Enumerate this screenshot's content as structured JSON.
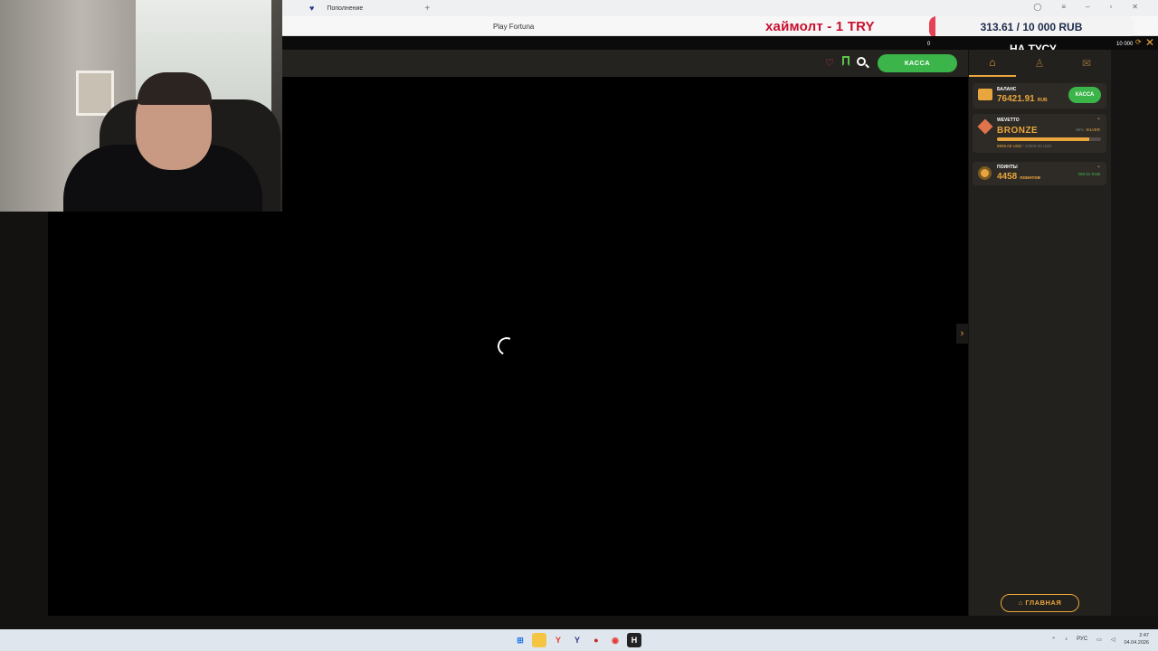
{
  "browser": {
    "tab_title": "Пополнение",
    "page_title": "Play Fortuna"
  },
  "overlay": {
    "promo_text": "хаймолт - 1 TRY",
    "goal_text": "313.61 / 10 000 RUB",
    "goal_progress": 0.031,
    "goal_min": "0",
    "goal_max": "10 000",
    "goal_label": "НА ТУСУ"
  },
  "header": {
    "kassa_label": "КАССА"
  },
  "sidebar": {
    "balance_label": "БАЛАНС",
    "balance_value": "76421.91",
    "balance_currency": "RUB",
    "balance_button": "КАССА",
    "loyalty_label": "WEVETTO",
    "loyalty_level": "BRONZE",
    "loyalty_next_pct": "89%",
    "loyalty_next_level": "SILVER",
    "loyalty_progress": 0.89,
    "loyalty_current": "8909.00 USD",
    "loyalty_total": "/ 10000.00 USD",
    "points_label": "ПОИНТЫ",
    "points_value": "4458",
    "points_unit": "поинтов",
    "points_rub": "398.91 RUB",
    "home_button": "ГЛАВНАЯ"
  },
  "taskbar": {
    "lang": "РУС",
    "time": "2:47",
    "date": "04.04.2026"
  },
  "colors": {
    "accent": "#e9a53e",
    "green": "#3bb54a",
    "promo": "#c8102e"
  }
}
